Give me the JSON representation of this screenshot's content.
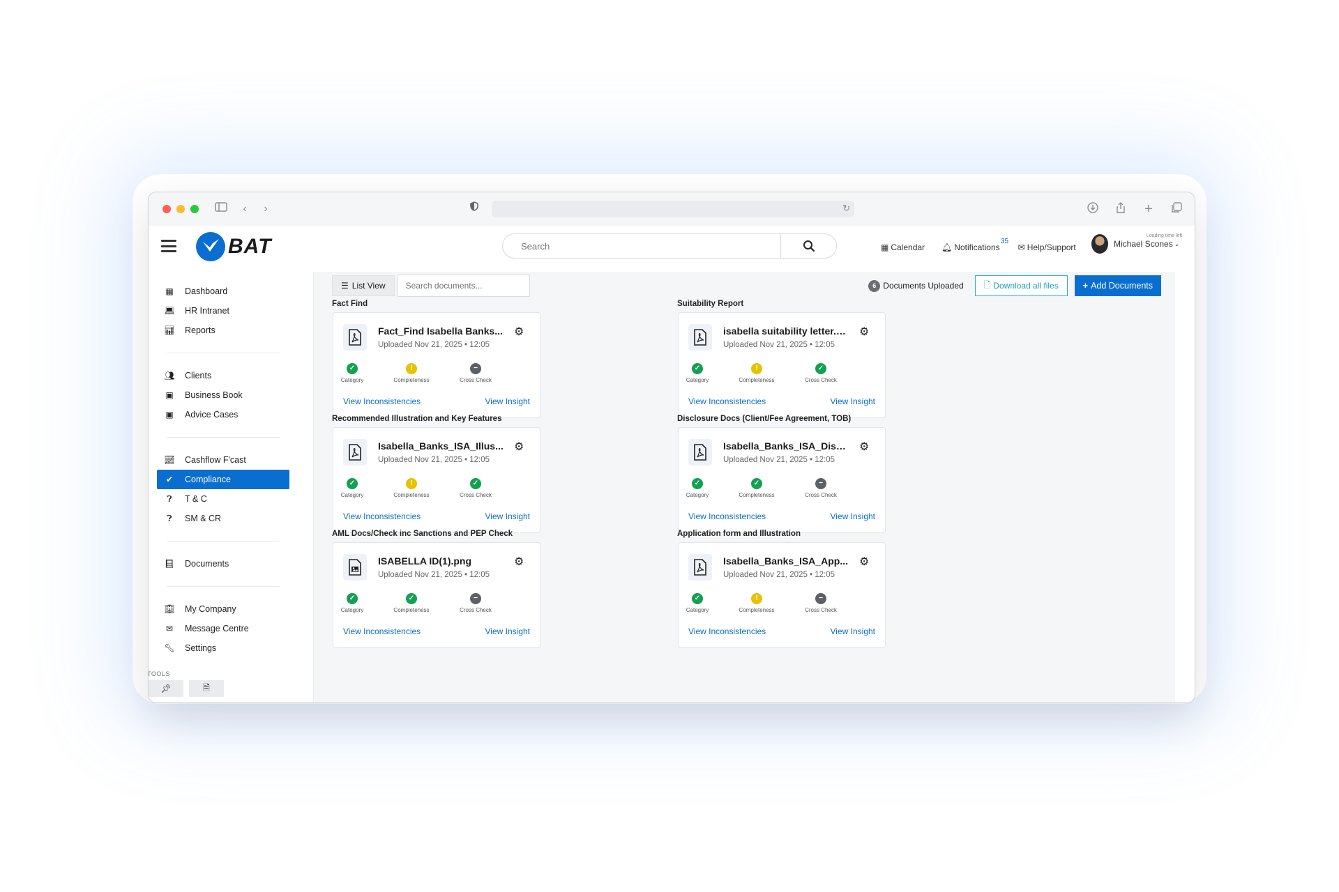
{
  "header": {
    "brand": "BAT",
    "search_placeholder": "Search",
    "links": [
      {
        "icon": "calendar-icon",
        "label": "Calendar"
      },
      {
        "icon": "bell-icon",
        "label": "Notifications"
      },
      {
        "icon": "envelope-icon",
        "label": "Help/Support"
      }
    ],
    "notification_count": "35",
    "user_name": "Michael Scones",
    "timer_label": "Loading time left"
  },
  "sidebar": {
    "groups": [
      [
        {
          "icon": "dashboard-icon",
          "label": "Dashboard"
        },
        {
          "icon": "laptop-icon",
          "label": "HR Intranet"
        },
        {
          "icon": "bar-chart-icon",
          "label": "Reports"
        }
      ],
      [
        {
          "icon": "users-icon",
          "label": "Clients"
        },
        {
          "icon": "money-icon",
          "label": "Business Book"
        },
        {
          "icon": "money-icon",
          "label": "Advice Cases"
        }
      ],
      [
        {
          "icon": "line-chart-icon",
          "label": "Cashflow F'cast"
        },
        {
          "icon": "check-icon",
          "label": "Compliance",
          "active": true
        },
        {
          "icon": "question-icon",
          "label": "T & C"
        },
        {
          "icon": "question-icon",
          "label": "SM & CR"
        }
      ],
      [
        {
          "icon": "book-icon",
          "label": "Documents"
        }
      ],
      [
        {
          "icon": "building-icon",
          "label": "My Company"
        },
        {
          "icon": "envelope-icon",
          "label": "Message Centre"
        },
        {
          "icon": "wrench-icon",
          "label": "Settings"
        }
      ]
    ],
    "tools_label": "TOOLS"
  },
  "toolbar": {
    "list_view_label": "List View",
    "doc_search_placeholder": "Search documents...",
    "uploaded_count": "6",
    "uploaded_label": "Documents Uploaded",
    "download_label": "Download all files",
    "add_label": "Add Documents"
  },
  "sections": [
    {
      "title": "Fact Find",
      "file": "Fact_Find Isabella Banks...",
      "type": "pdf",
      "date": "Uploaded Nov 21, 2025 • 12:05",
      "status": [
        "green",
        "yellow",
        "gray"
      ]
    },
    {
      "title": "Suitability Report",
      "file": "isabella suitability letter.p...",
      "type": "pdf",
      "date": "Uploaded Nov 21, 2025 • 12:05",
      "status": [
        "green",
        "yellow",
        "green"
      ]
    },
    {
      "title": "Recommended Illustration and Key Features",
      "file": "Isabella_Banks_ISA_Illus...",
      "type": "pdf",
      "date": "Uploaded Nov 21, 2025 • 12:05",
      "status": [
        "green",
        "yellow",
        "green"
      ]
    },
    {
      "title": "Disclosure Docs (Client/Fee Agreement, TOB)",
      "file": "Isabella_Banks_ISA_Disc...",
      "type": "pdf",
      "date": "Uploaded Nov 21, 2025 • 12:05",
      "status": [
        "green",
        "green",
        "gray"
      ]
    },
    {
      "title": "AML Docs/Check inc Sanctions and PEP Check",
      "file": "ISABELLA ID(1).png",
      "type": "image",
      "date": "Uploaded Nov 21, 2025 • 12:05",
      "status": [
        "green",
        "green",
        "gray"
      ]
    },
    {
      "title": "Application form and Illustration",
      "file": "Isabella_Banks_ISA_App...",
      "type": "pdf",
      "date": "Uploaded Nov 21, 2025 • 12:05",
      "status": [
        "green",
        "yellow",
        "gray"
      ]
    }
  ],
  "check_labels": [
    "Category",
    "Completeness",
    "Cross Check"
  ],
  "card_links": {
    "inconsistencies": "View Inconsistencies",
    "insight": "View Insight"
  },
  "colors": {
    "accent": "#0a6ed1",
    "ok": "#12a150",
    "warn": "#e6c200",
    "neutral": "#5d6166"
  }
}
